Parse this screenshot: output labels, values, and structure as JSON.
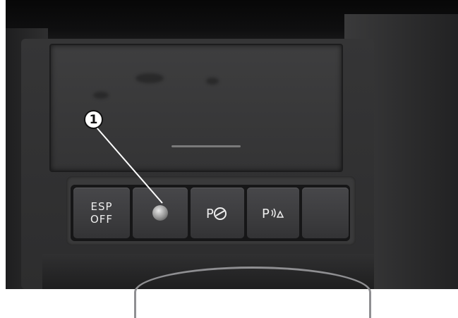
{
  "callout": {
    "number": "1"
  },
  "buttons": {
    "esp_line1": "ESP",
    "esp_line2": "OFF",
    "hill_icon": "hill-hold-icon",
    "park_icon": "park-distance-icon"
  }
}
